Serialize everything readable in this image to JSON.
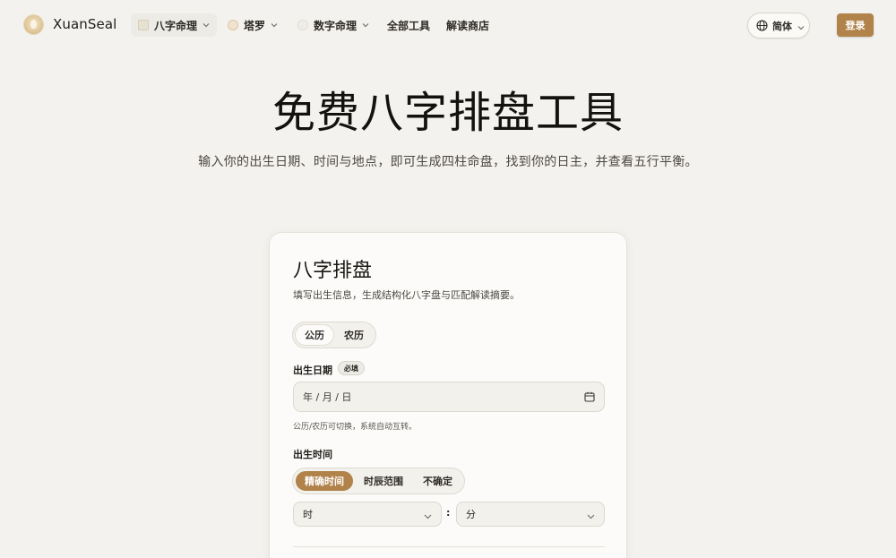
{
  "header": {
    "brand": "XuanSeal",
    "nav": [
      {
        "label": "八字命理",
        "icon": "bazi-thumb-icon"
      },
      {
        "label": "塔罗",
        "icon": "tarot-thumb-icon"
      },
      {
        "label": "数字命理",
        "icon": "numerology-thumb-icon"
      },
      {
        "label": "全部工具"
      },
      {
        "label": "解读商店"
      }
    ],
    "language": "简体",
    "login": "登录"
  },
  "hero": {
    "title": "免费八字排盘工具",
    "subtitle": "输入你的出生日期、时间与地点，即可生成四柱命盘，找到你的日主，并查看五行平衡。"
  },
  "card": {
    "title": "八字排盘",
    "description": "填写出生信息，生成结构化八字盘与匹配解读摘要。",
    "calendar_toggle": [
      "公历",
      "农历"
    ],
    "birth_date": {
      "label": "出生日期",
      "required_badge": "必填",
      "placeholder": "年 / 月 / 日",
      "hint": "公历/农历可切换，系统自动互转。"
    },
    "birth_time": {
      "label": "出生时间",
      "modes": [
        "精确时间",
        "时辰范围",
        "不确定"
      ],
      "hour_placeholder": "时",
      "separator": ":",
      "minute_placeholder": "分"
    }
  },
  "colors": {
    "accent": "#b1824a",
    "background": "#f4f2ee",
    "card": "#fcfbf9"
  }
}
